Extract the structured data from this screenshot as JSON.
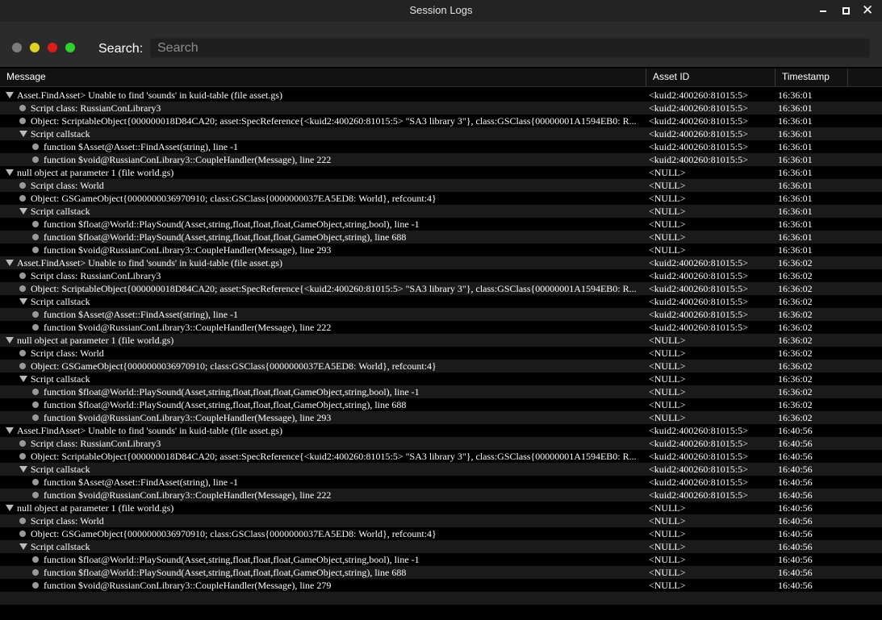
{
  "window": {
    "title": "Session Logs",
    "minimize_label": "Minimize",
    "maximize_label": "Maximize",
    "close_label": "Close"
  },
  "toolbar": {
    "filters": [
      {
        "name": "filter-gray",
        "color": "#7c7c7c"
      },
      {
        "name": "filter-yellow",
        "color": "#e0d320"
      },
      {
        "name": "filter-red",
        "color": "#e01a1a"
      },
      {
        "name": "filter-green",
        "color": "#2ed12e"
      }
    ],
    "search_label": "Search:",
    "search_placeholder": "Search",
    "search_value": ""
  },
  "columns": [
    "Message",
    "Asset ID",
    "Timestamp"
  ],
  "rows": [
    {
      "level": 0,
      "icon": "expanded",
      "message": "Asset.FindAsset> Unable to find 'sounds' in kuid-table (file asset.gs)",
      "asset": "<kuid2:400260:81015:5>",
      "time": "16:36:01"
    },
    {
      "level": 1,
      "icon": "bullet",
      "message": "Script class: RussianConLibrary3",
      "asset": "<kuid2:400260:81015:5>",
      "time": "16:36:01"
    },
    {
      "level": 1,
      "icon": "bullet",
      "message": "Object: ScriptableObject{000000018D84CA20; asset:SpecReference{<kuid2:400260:81015:5> \"SA3 library 3\"}, class:GSClass{00000001A1594EB0: R...",
      "asset": "<kuid2:400260:81015:5>",
      "time": "16:36:01"
    },
    {
      "level": 1,
      "icon": "expanded",
      "message": "Script callstack",
      "asset": "<kuid2:400260:81015:5>",
      "time": "16:36:01"
    },
    {
      "level": 2,
      "icon": "bullet",
      "message": "function $Asset@Asset::FindAsset(string), line -1",
      "asset": "<kuid2:400260:81015:5>",
      "time": "16:36:01"
    },
    {
      "level": 2,
      "icon": "bullet",
      "message": "function $void@RussianConLibrary3::CoupleHandler(Message), line 222",
      "asset": "<kuid2:400260:81015:5>",
      "time": "16:36:01"
    },
    {
      "level": 0,
      "icon": "expanded",
      "message": "null object at parameter 1 (file world.gs)",
      "asset": "<NULL>",
      "time": "16:36:01"
    },
    {
      "level": 1,
      "icon": "bullet",
      "message": "Script class: World",
      "asset": "<NULL>",
      "time": "16:36:01"
    },
    {
      "level": 1,
      "icon": "bullet",
      "message": "Object: GSGameObject{0000000036970910; class:GSClass{0000000037EA5ED8: World}, refcount:4}",
      "asset": "<NULL>",
      "time": "16:36:01"
    },
    {
      "level": 1,
      "icon": "expanded",
      "message": "Script callstack",
      "asset": "<NULL>",
      "time": "16:36:01"
    },
    {
      "level": 2,
      "icon": "bullet",
      "message": "function $float@World::PlaySound(Asset,string,float,float,float,GameObject,string,bool), line -1",
      "asset": "<NULL>",
      "time": "16:36:01"
    },
    {
      "level": 2,
      "icon": "bullet",
      "message": "function $float@World::PlaySound(Asset,string,float,float,float,GameObject,string), line 688",
      "asset": "<NULL>",
      "time": "16:36:01"
    },
    {
      "level": 2,
      "icon": "bullet",
      "message": "function $void@RussianConLibrary3::CoupleHandler(Message), line 293",
      "asset": "<NULL>",
      "time": "16:36:01"
    },
    {
      "level": 0,
      "icon": "expanded",
      "message": "Asset.FindAsset> Unable to find 'sounds' in kuid-table (file asset.gs)",
      "asset": "<kuid2:400260:81015:5>",
      "time": "16:36:02"
    },
    {
      "level": 1,
      "icon": "bullet",
      "message": "Script class: RussianConLibrary3",
      "asset": "<kuid2:400260:81015:5>",
      "time": "16:36:02"
    },
    {
      "level": 1,
      "icon": "bullet",
      "message": "Object: ScriptableObject{000000018D84CA20; asset:SpecReference{<kuid2:400260:81015:5> \"SA3 library 3\"}, class:GSClass{00000001A1594EB0: R...",
      "asset": "<kuid2:400260:81015:5>",
      "time": "16:36:02"
    },
    {
      "level": 1,
      "icon": "expanded",
      "message": "Script callstack",
      "asset": "<kuid2:400260:81015:5>",
      "time": "16:36:02"
    },
    {
      "level": 2,
      "icon": "bullet",
      "message": "function $Asset@Asset::FindAsset(string), line -1",
      "asset": "<kuid2:400260:81015:5>",
      "time": "16:36:02"
    },
    {
      "level": 2,
      "icon": "bullet",
      "message": "function $void@RussianConLibrary3::CoupleHandler(Message), line 222",
      "asset": "<kuid2:400260:81015:5>",
      "time": "16:36:02"
    },
    {
      "level": 0,
      "icon": "expanded",
      "message": "null object at parameter 1 (file world.gs)",
      "asset": "<NULL>",
      "time": "16:36:02"
    },
    {
      "level": 1,
      "icon": "bullet",
      "message": "Script class: World",
      "asset": "<NULL>",
      "time": "16:36:02"
    },
    {
      "level": 1,
      "icon": "bullet",
      "message": "Object: GSGameObject{0000000036970910; class:GSClass{0000000037EA5ED8: World}, refcount:4}",
      "asset": "<NULL>",
      "time": "16:36:02"
    },
    {
      "level": 1,
      "icon": "expanded",
      "message": "Script callstack",
      "asset": "<NULL>",
      "time": "16:36:02"
    },
    {
      "level": 2,
      "icon": "bullet",
      "message": "function $float@World::PlaySound(Asset,string,float,float,float,GameObject,string,bool), line -1",
      "asset": "<NULL>",
      "time": "16:36:02"
    },
    {
      "level": 2,
      "icon": "bullet",
      "message": "function $float@World::PlaySound(Asset,string,float,float,float,GameObject,string), line 688",
      "asset": "<NULL>",
      "time": "16:36:02"
    },
    {
      "level": 2,
      "icon": "bullet",
      "message": "function $void@RussianConLibrary3::CoupleHandler(Message), line 293",
      "asset": "<NULL>",
      "time": "16:36:02"
    },
    {
      "level": 0,
      "icon": "expanded",
      "message": "Asset.FindAsset> Unable to find 'sounds' in kuid-table (file asset.gs)",
      "asset": "<kuid2:400260:81015:5>",
      "time": "16:40:56"
    },
    {
      "level": 1,
      "icon": "bullet",
      "message": "Script class: RussianConLibrary3",
      "asset": "<kuid2:400260:81015:5>",
      "time": "16:40:56"
    },
    {
      "level": 1,
      "icon": "bullet",
      "message": "Object: ScriptableObject{000000018D84CA20; asset:SpecReference{<kuid2:400260:81015:5> \"SA3 library 3\"}, class:GSClass{00000001A1594EB0: R...",
      "asset": "<kuid2:400260:81015:5>",
      "time": "16:40:56"
    },
    {
      "level": 1,
      "icon": "expanded",
      "message": "Script callstack",
      "asset": "<kuid2:400260:81015:5>",
      "time": "16:40:56"
    },
    {
      "level": 2,
      "icon": "bullet",
      "message": "function $Asset@Asset::FindAsset(string), line -1",
      "asset": "<kuid2:400260:81015:5>",
      "time": "16:40:56"
    },
    {
      "level": 2,
      "icon": "bullet",
      "message": "function $void@RussianConLibrary3::CoupleHandler(Message), line 222",
      "asset": "<kuid2:400260:81015:5>",
      "time": "16:40:56"
    },
    {
      "level": 0,
      "icon": "expanded",
      "message": "null object at parameter 1 (file world.gs)",
      "asset": "<NULL>",
      "time": "16:40:56"
    },
    {
      "level": 1,
      "icon": "bullet",
      "message": "Script class: World",
      "asset": "<NULL>",
      "time": "16:40:56"
    },
    {
      "level": 1,
      "icon": "bullet",
      "message": "Object: GSGameObject{0000000036970910; class:GSClass{0000000037EA5ED8: World}, refcount:4}",
      "asset": "<NULL>",
      "time": "16:40:56"
    },
    {
      "level": 1,
      "icon": "expanded",
      "message": "Script callstack",
      "asset": "<NULL>",
      "time": "16:40:56"
    },
    {
      "level": 2,
      "icon": "bullet",
      "message": "function $float@World::PlaySound(Asset,string,float,float,float,GameObject,string,bool), line -1",
      "asset": "<NULL>",
      "time": "16:40:56"
    },
    {
      "level": 2,
      "icon": "bullet",
      "message": "function $float@World::PlaySound(Asset,string,float,float,float,GameObject,string), line 688",
      "asset": "<NULL>",
      "time": "16:40:56"
    },
    {
      "level": 2,
      "icon": "bullet",
      "message": "function $void@RussianConLibrary3::CoupleHandler(Message), line 279",
      "asset": "<NULL>",
      "time": "16:40:56"
    }
  ]
}
